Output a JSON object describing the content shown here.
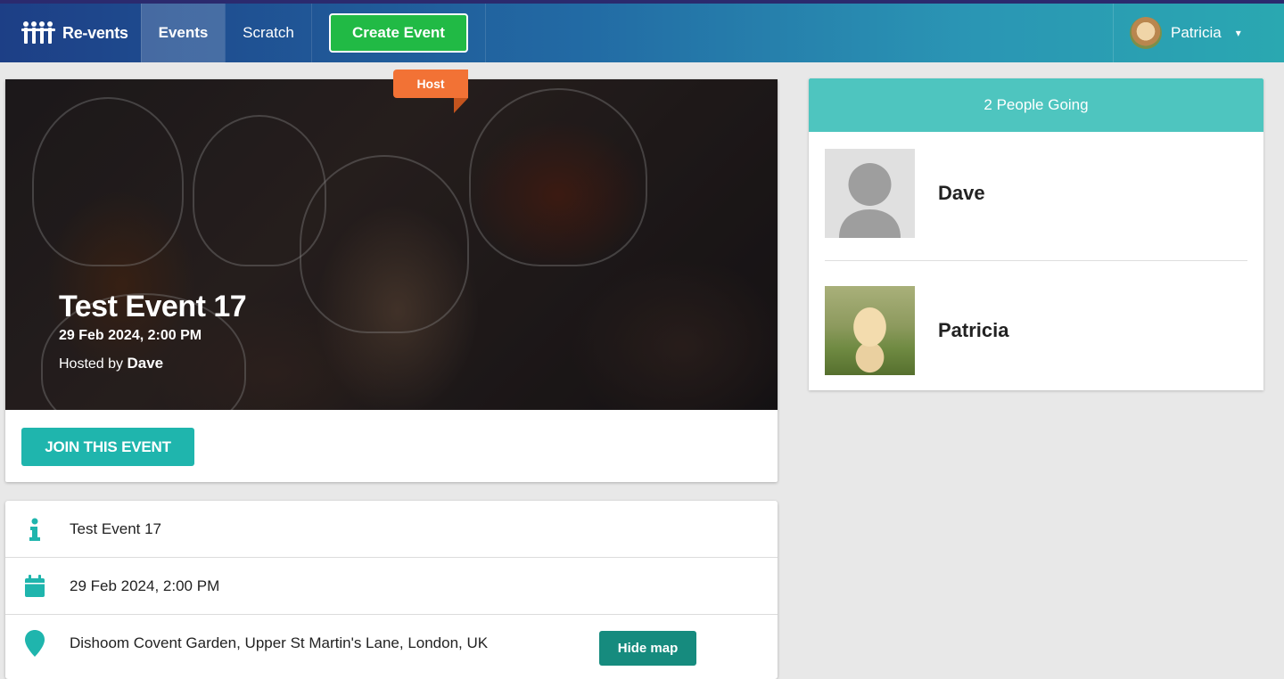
{
  "navbar": {
    "brand": "Re-vents",
    "items": [
      {
        "label": "Events",
        "active": true
      },
      {
        "label": "Scratch",
        "active": false
      }
    ],
    "create_button": "Create Event",
    "user": {
      "name": "Patricia",
      "caret": "▾"
    }
  },
  "event": {
    "title": "Test Event 17",
    "date": "29 Feb 2024, 2:00 PM",
    "hosted_by_prefix": "Hosted by",
    "host": "Dave",
    "join_button": "JOIN THIS EVENT"
  },
  "info": {
    "description": "Test Event 17",
    "date": "29 Feb 2024, 2:00 PM",
    "venue": "Dishoom Covent Garden, Upper St Martin's Lane, London, UK",
    "hide_map_button": "Hide map",
    "icons": [
      "info-icon",
      "calendar-icon",
      "map-marker-icon"
    ]
  },
  "attendees": {
    "header": "2 People Going",
    "host_label": "Host",
    "people": [
      {
        "name": "Dave",
        "is_host": true
      },
      {
        "name": "Patricia",
        "is_host": false
      }
    ]
  },
  "colors": {
    "teal": "#1fb5ad",
    "header_teal": "#4ec5bf",
    "create_green": "#21ba45",
    "host_orange": "#f27235",
    "hide_map": "#168b7e"
  }
}
